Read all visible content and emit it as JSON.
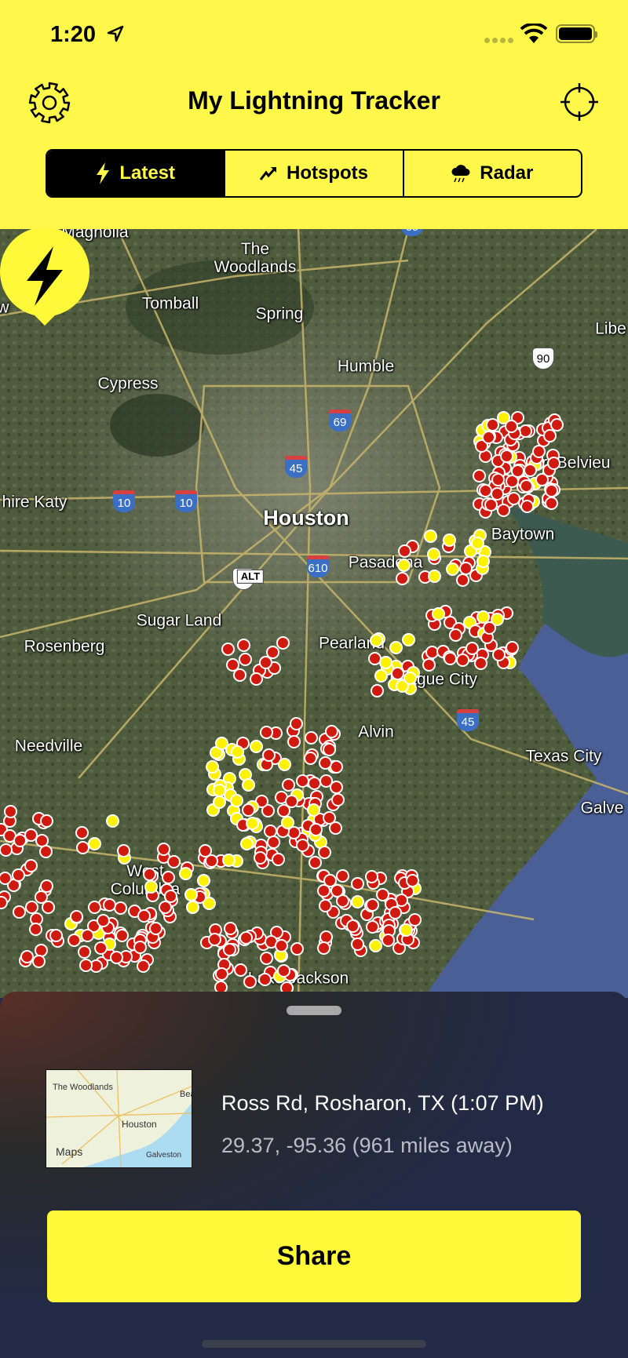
{
  "status_bar": {
    "time": "1:20"
  },
  "header": {
    "title": "My Lightning Tracker",
    "left_icon": "gear-icon",
    "right_icon": "crosshair-icon",
    "accent": "#fff84a"
  },
  "tabs": [
    {
      "label": "Latest",
      "icon": "bolt-icon",
      "selected": true
    },
    {
      "label": "Hotspots",
      "icon": "trend-icon",
      "selected": false
    },
    {
      "label": "Radar",
      "icon": "cloud-rain-icon",
      "selected": false
    }
  ],
  "map": {
    "labels": [
      {
        "text": "Magnolia"
      },
      {
        "text": "The\nWoodlands"
      },
      {
        "text": "Tomball"
      },
      {
        "text": "Spring"
      },
      {
        "text": "Humble"
      },
      {
        "text": "Cypress"
      },
      {
        "text": "Houston"
      },
      {
        "text": "hire Katy"
      },
      {
        "text": "Baytown"
      },
      {
        "text": "ort Belvieu"
      },
      {
        "text": "Pasadena"
      },
      {
        "text": "Sugar Land"
      },
      {
        "text": "Rosenberg"
      },
      {
        "text": "Pearland"
      },
      {
        "text": "League City"
      },
      {
        "text": "Alvin"
      },
      {
        "text": "Needville"
      },
      {
        "text": "Texas City"
      },
      {
        "text": "Galve"
      },
      {
        "text": "Libe"
      },
      {
        "text": "West\nColumbia"
      },
      {
        "text": "Lake Jackson"
      },
      {
        "text": "w"
      }
    ],
    "shields": [
      "69",
      "45",
      "10",
      "10",
      "610",
      "90",
      "90",
      "45",
      "69"
    ],
    "shield_alt": "ALT",
    "strike_colors": {
      "old": "#d0190f",
      "recent": "#fff200"
    }
  },
  "sheet": {
    "address": "Ross Rd, Rosharon, TX (1:07 PM)",
    "coords": "29.37, -95.36 (961 miles away)",
    "thumbnail_labels": [
      "The Woodlands",
      "Houston",
      "Galveston",
      "Bea",
      "Maps"
    ],
    "share_label": "Share"
  }
}
